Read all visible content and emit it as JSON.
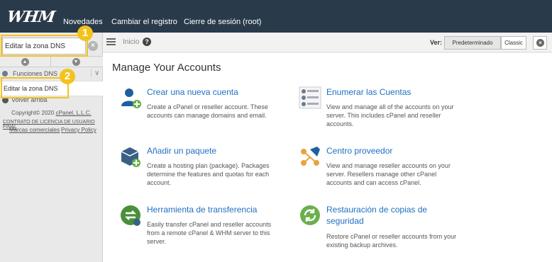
{
  "app": {
    "logo_text": "WHM"
  },
  "topnav": [
    "Novedades",
    "Cambiar el registro",
    "Cierre de sesión (root)"
  ],
  "sidebar": {
    "search_value": "Editar la zona DNS",
    "group_label": "Funciones DNS",
    "result_item": "Editar la zona DNS",
    "back_label": "Volver arriba",
    "copyright_prefix": "Copyright© 2020",
    "copyright_link": "cPanel, L.L.C.",
    "license_link": "CONTRATO DE LICENCIA DE USUARIO FINAL",
    "trademarks_link": "Marcas comerciales",
    "privacy_link": "Privacy Policy"
  },
  "toolbar": {
    "breadcrumb": "Inicio",
    "view_label": "Ver:",
    "view_default": "Predeterminado",
    "view_classic": "Classic"
  },
  "callouts": [
    "1",
    "2"
  ],
  "main": {
    "title": "Manage Your Accounts",
    "cards": [
      {
        "title": "Crear una nueva cuenta",
        "desc": [
          "Create a cPanel or reseller account. These",
          "accounts can manage domains and email."
        ],
        "icon": "create-account-icon"
      },
      {
        "title": "Enumerar las Cuentas",
        "desc": [
          "View and manage all of the accounts on your",
          "server. This includes cPanel and reseller",
          "accounts."
        ],
        "icon": "list-accounts-icon"
      },
      {
        "title": "Añadir un paquete",
        "desc": [
          "Create a hosting plan (package). Packages",
          "determine the features and quotas for each",
          "account."
        ],
        "icon": "add-package-icon"
      },
      {
        "title": "Centro proveedor",
        "desc": [
          "View and manage reseller accounts on your",
          "server. Resellers manage other cPanel",
          "accounts and can access cPanel."
        ],
        "icon": "reseller-center-icon"
      },
      {
        "title": "Herramienta de transferencia",
        "desc": [
          "Easily transfer cPanel and reseller accounts",
          "from a remote cPanel & WHM server to this",
          "server."
        ],
        "icon": "transfer-tool-icon"
      },
      {
        "title_lines": [
          "Restauración de copias de",
          "seguridad"
        ],
        "desc": [
          "Restore cPanel or reseller accounts from your",
          "existing backup archives."
        ],
        "icon": "backup-restore-icon"
      }
    ]
  },
  "colors": {
    "topbar": "#293a4a",
    "link": "#1f70c1",
    "callout": "#f3c31c",
    "icon_green": "#6ab04c"
  }
}
